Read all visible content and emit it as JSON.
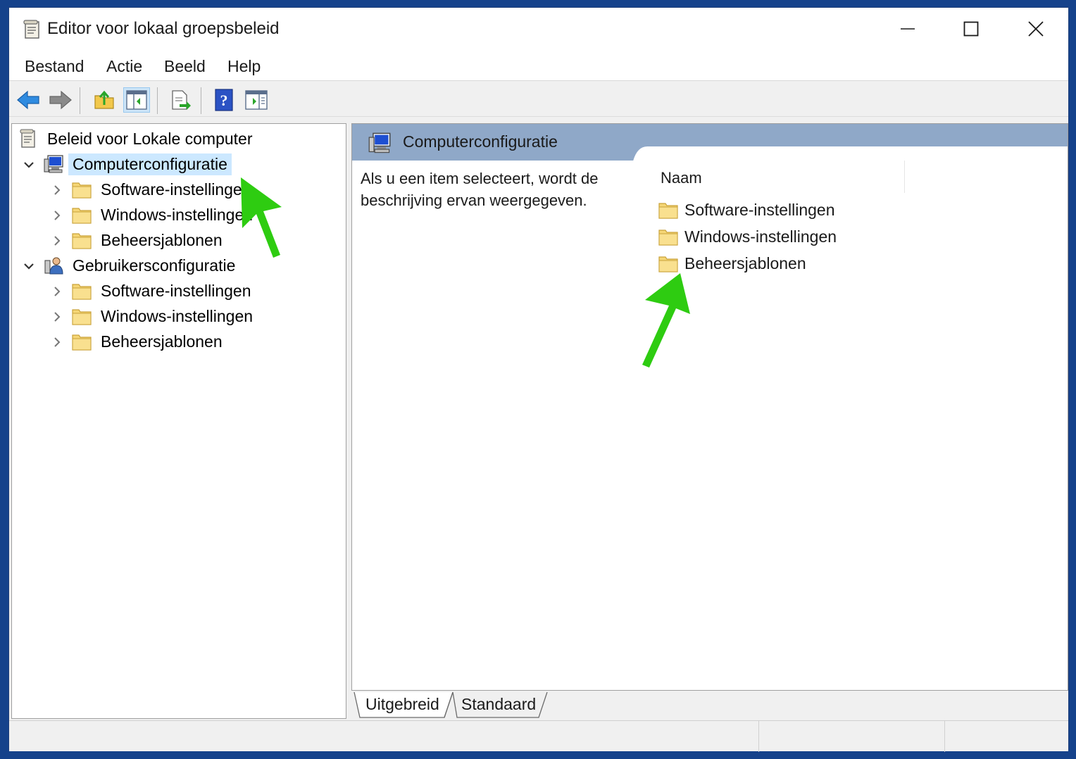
{
  "window": {
    "title": "Editor voor lokaal groepsbeleid"
  },
  "menu": {
    "items": [
      "Bestand",
      "Actie",
      "Beeld",
      "Help"
    ]
  },
  "toolbar": {
    "buttons": [
      "back-icon",
      "forward-icon",
      "up-folder-icon",
      "show-hide-console-tree-icon",
      "export-list-icon",
      "help-icon",
      "show-action-pane-icon"
    ]
  },
  "tree": {
    "root": "Beleid voor Lokale computer",
    "computer_config": "Computerconfiguratie",
    "computer_children": [
      "Software-instellingen",
      "Windows-instellingen",
      "Beheersjablonen"
    ],
    "user_config": "Gebruikersconfiguratie",
    "user_children": [
      "Software-instellingen",
      "Windows-instellingen",
      "Beheersjablonen"
    ]
  },
  "detail": {
    "title": "Computerconfiguratie",
    "description": "Als u een item selecteert, wordt de beschrijving ervan weergegeven.",
    "column_header": "Naam",
    "items": [
      "Software-instellingen",
      "Windows-instellingen",
      "Beheersjablonen"
    ]
  },
  "tabs": {
    "extended": "Uitgebreid",
    "standard": "Standaard"
  },
  "colors": {
    "banner": "#8fa8c8",
    "selection": "#cce8ff",
    "arrow": "#2ecc11",
    "folder": "#f5d676"
  }
}
